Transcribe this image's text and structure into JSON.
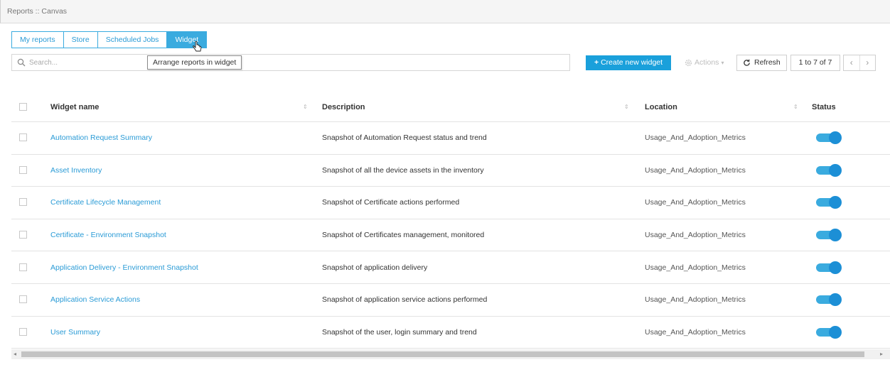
{
  "breadcrumb": "Reports :: Canvas",
  "tabs": [
    {
      "label": "My reports",
      "active": false
    },
    {
      "label": "Store",
      "active": false
    },
    {
      "label": "Scheduled Jobs",
      "active": false
    },
    {
      "label": "Widget",
      "active": true
    }
  ],
  "tooltip": "Arrange reports in widget",
  "search": {
    "placeholder": "Search...",
    "value": ""
  },
  "toolbar": {
    "create_label": "Create new widget",
    "actions_label": "Actions",
    "refresh_label": "Refresh",
    "pager_text": "1 to 7 of 7",
    "prev": "‹",
    "next": "›"
  },
  "table": {
    "columns": [
      "Widget name",
      "Description",
      "Location",
      "Status"
    ],
    "rows": [
      {
        "name": "Automation Request Summary",
        "description": "Snapshot of Automation Request status and trend",
        "location": "Usage_And_Adoption_Metrics",
        "status": true
      },
      {
        "name": "Asset Inventory",
        "description": "Snapshot of all the device assets in the inventory",
        "location": "Usage_And_Adoption_Metrics",
        "status": true
      },
      {
        "name": "Certificate Lifecycle Management",
        "description": "Snapshot of Certificate actions performed",
        "location": "Usage_And_Adoption_Metrics",
        "status": true
      },
      {
        "name": "Certificate - Environment Snapshot",
        "description": "Snapshot of Certificates management, monitored",
        "location": "Usage_And_Adoption_Metrics",
        "status": true
      },
      {
        "name": "Application Delivery - Environment Snapshot",
        "description": "Snapshot of application delivery",
        "location": "Usage_And_Adoption_Metrics",
        "status": true
      },
      {
        "name": "Application Service Actions",
        "description": "Snapshot of application service actions performed",
        "location": "Usage_And_Adoption_Metrics",
        "status": true
      },
      {
        "name": "User Summary",
        "description": "Snapshot of the user, login summary and trend",
        "location": "Usage_And_Adoption_Metrics",
        "status": true
      }
    ]
  },
  "colors": {
    "accent": "#3aabdf",
    "primary_button": "#1aa0db",
    "link": "#2a9bd6",
    "toggle_knob": "#1c8fd6"
  }
}
